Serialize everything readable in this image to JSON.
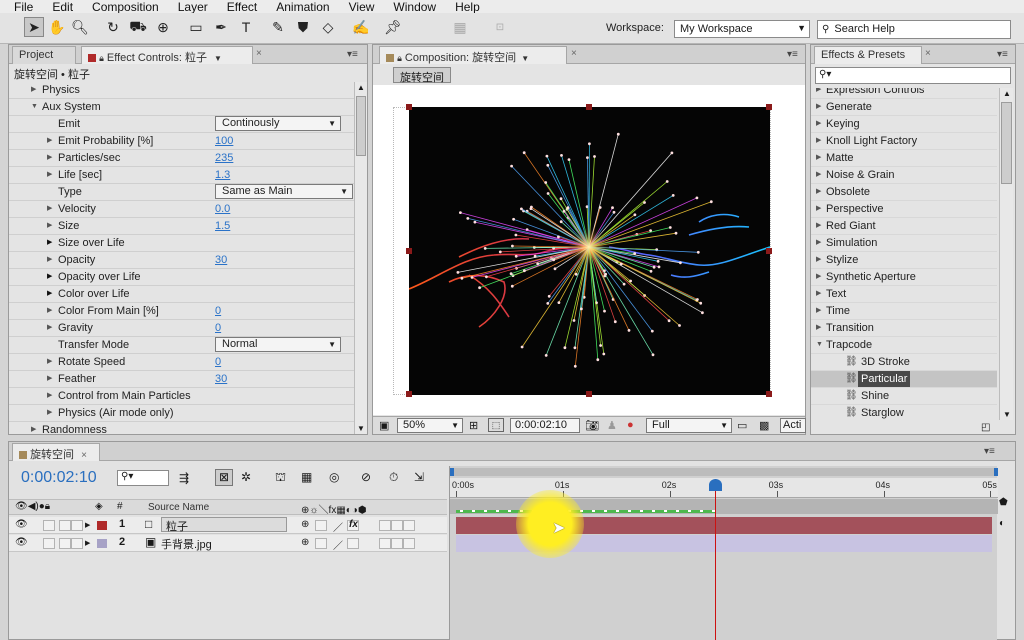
{
  "menu": [
    "File",
    "Edit",
    "Composition",
    "Layer",
    "Effect",
    "Animation",
    "View",
    "Window",
    "Help"
  ],
  "toolbar": {
    "workspace_label": "Workspace:",
    "workspace_value": "My Workspace",
    "search_help_placeholder": "Search Help",
    "tools": [
      "selection-tool",
      "hand-tool",
      "zoom-tool",
      "rotate-tool",
      "camera-tool",
      "pan-behind-tool",
      "rectangle-tool",
      "pen-tool",
      "text-tool",
      "brush-tool",
      "clone-stamp-tool",
      "eraser-tool",
      "roto-brush-tool",
      "puppet-pin-tool"
    ]
  },
  "project_panel": {
    "tab_project": "Project",
    "tab_effect_controls": "Effect Controls: 粒子",
    "breadcrumb": "旋转空间 • 粒子",
    "rows": [
      {
        "label": "Physics",
        "indent": 1,
        "twirl": "closed"
      },
      {
        "label": "Aux System",
        "indent": 1,
        "twirl": "open"
      },
      {
        "label": "Emit",
        "indent": 2,
        "twirl": "none",
        "dropdown": "Continously"
      },
      {
        "label": "Emit Probability [%]",
        "indent": 2,
        "twirl": "closed",
        "value": "100"
      },
      {
        "label": "Particles/sec",
        "indent": 2,
        "twirl": "closed",
        "value": "235"
      },
      {
        "label": "Life [sec]",
        "indent": 2,
        "twirl": "closed",
        "value": "1.3"
      },
      {
        "label": "Type",
        "indent": 2,
        "twirl": "none",
        "dropdown": "Same as Main"
      },
      {
        "label": "Velocity",
        "indent": 2,
        "twirl": "closed",
        "value": "0.0"
      },
      {
        "label": "Size",
        "indent": 2,
        "twirl": "closed",
        "value": "1.5"
      },
      {
        "label": "Size over Life",
        "indent": 2,
        "twirl": "closed-dark"
      },
      {
        "label": "Opacity",
        "indent": 2,
        "twirl": "closed",
        "value": "30"
      },
      {
        "label": "Opacity over Life",
        "indent": 2,
        "twirl": "closed-dark"
      },
      {
        "label": "Color over Life",
        "indent": 2,
        "twirl": "closed-dark"
      },
      {
        "label": "Color From Main [%]",
        "indent": 2,
        "twirl": "closed",
        "value": "0"
      },
      {
        "label": "Gravity",
        "indent": 2,
        "twirl": "closed",
        "value": "0"
      },
      {
        "label": "Transfer Mode",
        "indent": 2,
        "twirl": "none",
        "dropdown": "Normal"
      },
      {
        "label": "Rotate Speed",
        "indent": 2,
        "twirl": "closed",
        "value": "0"
      },
      {
        "label": "Feather",
        "indent": 2,
        "twirl": "closed",
        "value": "30"
      },
      {
        "label": "Control from Main Particles",
        "indent": 2,
        "twirl": "closed"
      },
      {
        "label": "Physics (Air mode only)",
        "indent": 2,
        "twirl": "closed"
      },
      {
        "label": "Randomness",
        "indent": 1,
        "twirl": "closed"
      }
    ]
  },
  "composition_panel": {
    "tab": "Composition: 旋转空间",
    "comp_button": "旋转空间",
    "zoom": "50%",
    "timecode": "0:00:02:10",
    "resolution": "Full",
    "view_label": "Acti"
  },
  "effects_presets": {
    "tab": "Effects & Presets",
    "search_placeholder": "",
    "categories": [
      "Expression Controls",
      "Generate",
      "Keying",
      "Knoll Light Factory",
      "Matte",
      "Noise & Grain",
      "Obsolete",
      "Perspective",
      "Red Giant",
      "Simulation",
      "Stylize",
      "Synthetic Aperture",
      "Text",
      "Time",
      "Transition"
    ],
    "open_category": "Trapcode",
    "trapcode_items": [
      "3D Stroke",
      "Particular",
      "Shine",
      "Starglow"
    ],
    "selected_item": "Particular"
  },
  "timeline": {
    "tab": "旋转空间",
    "timecode": "0:00:02:10",
    "source_name_header": "Source Name",
    "ruler": [
      "0:00s",
      "01s",
      "02s",
      "03s",
      "04s",
      "05s"
    ],
    "playhead_seconds": 2.42,
    "duration_seconds": 5,
    "layers": [
      {
        "index": "1",
        "name": "粒子",
        "label_color": "#b02a2a",
        "has_fx": true
      },
      {
        "index": "2",
        "name": "手背景.jpg",
        "label_color": "#a7a2c6",
        "has_fx": false
      }
    ]
  },
  "colors": {
    "timecode_blue": "#2a6fbf",
    "layer1_bar": "#a3515b",
    "layer2_bar": "#c8c3e2",
    "playhead": "#cc1111",
    "cursor_highlight": "#ffee22",
    "work_area": "#4db84d"
  }
}
